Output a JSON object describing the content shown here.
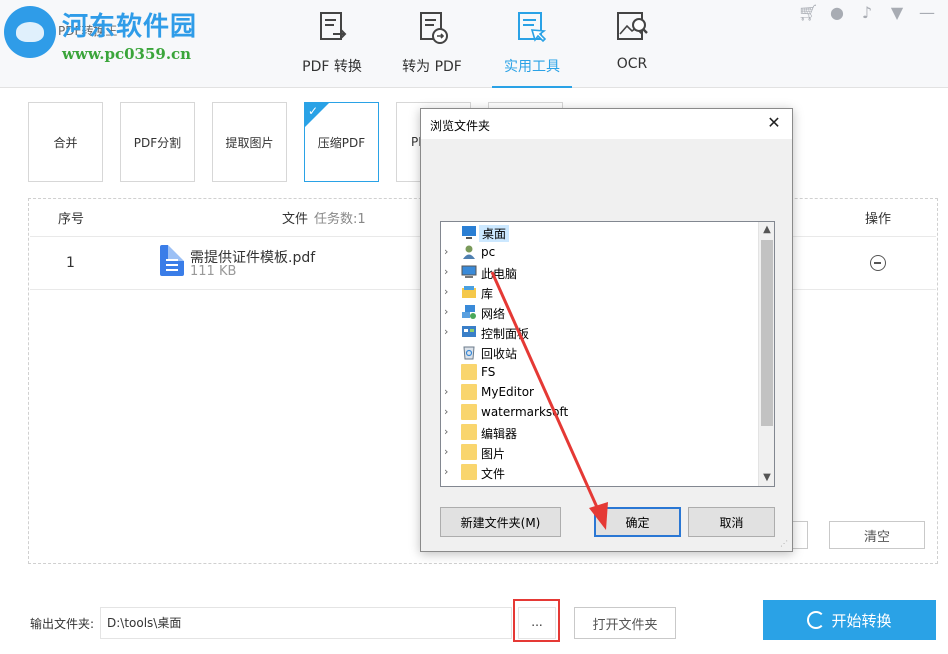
{
  "header": {
    "watermark_title": "河东软件园",
    "watermark_url": "www.pc0359.cn",
    "app_name": "PDF转换王",
    "tabs": [
      {
        "label": "PDF 转换",
        "icon": "pdf-convert-icon"
      },
      {
        "label": "转为 PDF",
        "icon": "to-pdf-icon"
      },
      {
        "label": "实用工具",
        "icon": "tools-icon",
        "active": true
      },
      {
        "label": "OCR",
        "icon": "ocr-icon"
      }
    ],
    "top_icons": [
      "cart-icon",
      "user-icon",
      "bell-icon",
      "dropdown-icon",
      "minimize-icon"
    ]
  },
  "tools": [
    {
      "label": "合并"
    },
    {
      "label": "PDF分割"
    },
    {
      "label": "提取图片"
    },
    {
      "label": "压缩PDF",
      "active": true
    },
    {
      "label": "PI"
    }
  ],
  "table": {
    "col_index": "序号",
    "col_file": "文件",
    "task_count": "任务数:1",
    "col_action": "操作",
    "rows": [
      {
        "index": "1",
        "file_name": "需提供证件模板.pdf",
        "file_size": "111 KB"
      }
    ]
  },
  "buttons": {
    "clear": "清空",
    "browse": "...",
    "open_folder": "打开文件夹",
    "start": "开始转换"
  },
  "output": {
    "label": "输出文件夹:",
    "path": "D:\\tools\\桌面"
  },
  "dialog": {
    "title": "浏览文件夹",
    "close": "✕",
    "tree": [
      {
        "label": "桌面",
        "icon": "desktop-icon",
        "selected": true,
        "expandable": false
      },
      {
        "label": "pc",
        "icon": "user-folder-icon",
        "expandable": true
      },
      {
        "label": "此电脑",
        "icon": "computer-icon",
        "expandable": true
      },
      {
        "label": "库",
        "icon": "library-icon",
        "expandable": true
      },
      {
        "label": "网络",
        "icon": "network-icon",
        "expandable": true
      },
      {
        "label": "控制面板",
        "icon": "control-panel-icon",
        "expandable": true
      },
      {
        "label": "回收站",
        "icon": "recycle-bin-icon",
        "expandable": false
      },
      {
        "label": "FS",
        "icon": "folder-icon",
        "expandable": false
      },
      {
        "label": "MyEditor",
        "icon": "folder-icon",
        "expandable": true
      },
      {
        "label": "watermarksoft",
        "icon": "folder-icon",
        "expandable": true
      },
      {
        "label": "编辑器",
        "icon": "folder-icon",
        "expandable": true
      },
      {
        "label": "图片",
        "icon": "folder-icon",
        "expandable": true
      },
      {
        "label": "文件",
        "icon": "folder-icon",
        "expandable": true
      }
    ],
    "new_folder": "新建文件夹(M)",
    "ok": "确定",
    "cancel": "取消"
  },
  "colors": {
    "accent": "#2aa2e6",
    "annotation": "#e53935"
  }
}
